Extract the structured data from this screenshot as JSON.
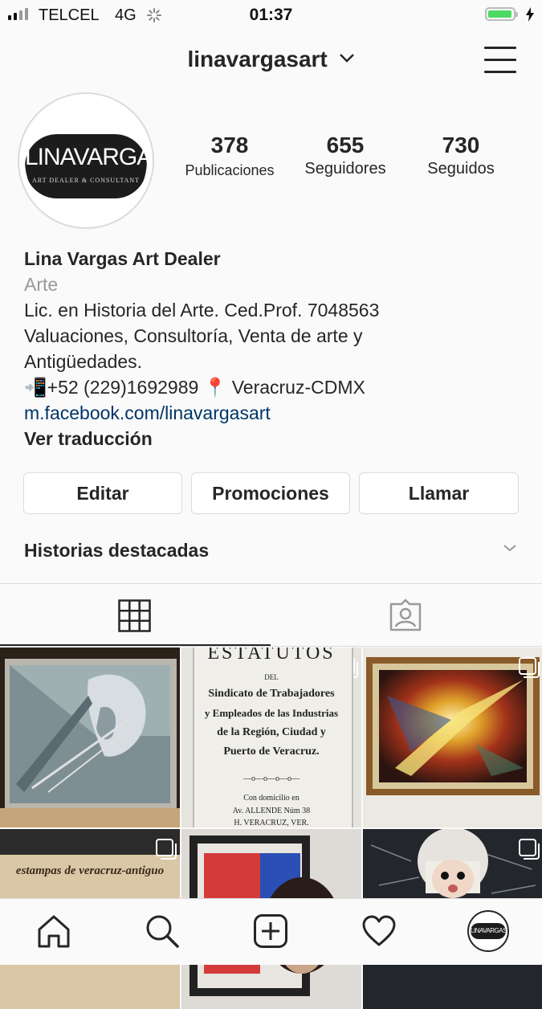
{
  "status_bar": {
    "carrier": "TELCEL",
    "network": "4G",
    "time": "01:37",
    "colors": {
      "battery": "#4cd964"
    }
  },
  "header": {
    "username": "linavargasart",
    "icons": {
      "dropdown": "chevron-down-icon",
      "menu": "hamburger-menu-icon"
    }
  },
  "profile": {
    "avatar": {
      "logo_text": "LINAVARGAS",
      "logo_subtitle": "ART DEALER & CONSULTANT"
    },
    "stats": [
      {
        "value": "378",
        "label": "Publicaciones"
      },
      {
        "value": "655",
        "label": "Seguidores"
      },
      {
        "value": "730",
        "label": "Seguidos"
      }
    ],
    "bio": {
      "name": "Lina Vargas Art Dealer",
      "category": "Arte",
      "line1": "Lic. en Historia del Arte. Ced.Prof. 7048563",
      "line2": "Valuaciones, Consultoría, Venta de arte y",
      "line3": "Antigüedades.",
      "line4_phone": "📲+52 (229)1692989",
      "line4_location": "📍 Veracruz-CDMX",
      "link": "m.facebook.com/linavargasart",
      "translate": "Ver traducción"
    }
  },
  "actions": {
    "edit": "Editar",
    "promotions": "Promociones",
    "call": "Llamar"
  },
  "highlights": {
    "label": "Historias destacadas"
  },
  "tabs": {
    "grid_icon": "grid-icon",
    "tagged_icon": "tagged-photos-icon",
    "active": "grid"
  },
  "posts": {
    "estatutos": {
      "title": "ESTATUTOS",
      "del": "DEL",
      "l1": "Sindicato de Trabajadores",
      "l2": "y Empleados de las Industrias",
      "l3": "de la Región, Ciudad y",
      "l4": "Puerto de Veracruz.",
      "sep": "—o—o—o—o—",
      "d1": "Con domicilio en",
      "d2": "Av. ALLENDE Núm 38",
      "d3": "H. VERACRUZ, VER."
    },
    "estampas": "estampas de veracruz-antiguo"
  },
  "bottom_nav": {
    "icons": [
      "home-icon",
      "search-icon",
      "add-post-icon",
      "heart-icon",
      "profile-avatar"
    ],
    "avatar_text": "LINAVARGAS"
  }
}
